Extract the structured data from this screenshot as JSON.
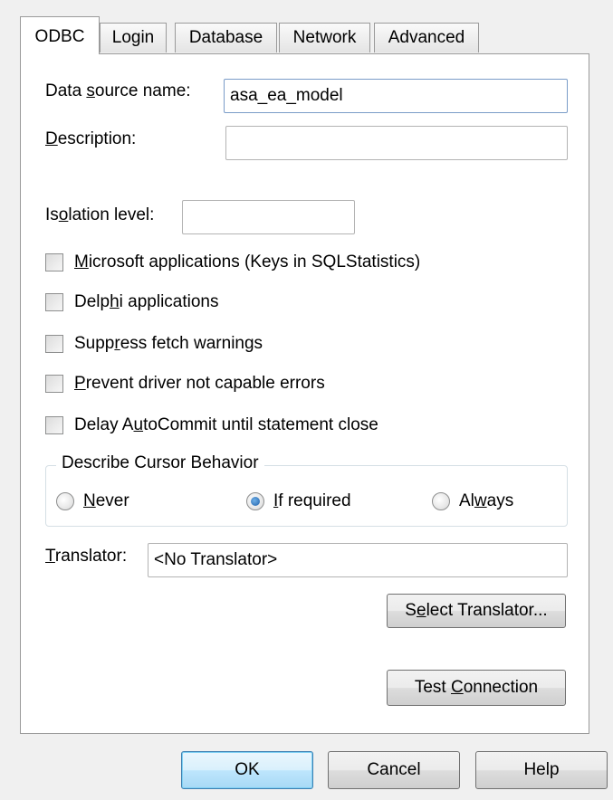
{
  "tabs": [
    {
      "label": "ODBC",
      "active": true
    },
    {
      "label": "Login"
    },
    {
      "label": "Database"
    },
    {
      "label": "Network"
    },
    {
      "label": "Advanced"
    }
  ],
  "fields": {
    "dsn_label_pre": "Data ",
    "dsn_label_ul": "s",
    "dsn_label_post": "ource name:",
    "dsn_value": "asa_ea_model",
    "desc_label_ul": "D",
    "desc_label_post": "escription:",
    "desc_value": "",
    "isolation_label_pre": "Is",
    "isolation_label_ul": "o",
    "isolation_label_post": "lation level:",
    "isolation_value": ""
  },
  "checkboxes": [
    {
      "pre": "",
      "ul": "M",
      "post": "icrosoft applications (Keys in SQLStatistics)",
      "checked": false
    },
    {
      "pre": "Delp",
      "ul": "h",
      "post": "i applications",
      "checked": false
    },
    {
      "pre": "Supp",
      "ul": "r",
      "post": "ess fetch warnings",
      "checked": false
    },
    {
      "pre": "",
      "ul": "P",
      "post": "revent driver not capable errors",
      "checked": false
    },
    {
      "pre": "Delay A",
      "ul": "u",
      "post": "toCommit until statement close",
      "checked": false
    }
  ],
  "cursor_group": {
    "title": "Describe Cursor Behavior",
    "options": [
      {
        "pre": "",
        "ul": "N",
        "post": "ever",
        "selected": false
      },
      {
        "pre": "",
        "ul": "I",
        "post": "f required",
        "selected": true
      },
      {
        "pre": "Al",
        "ul": "w",
        "post": "ays",
        "selected": false
      }
    ]
  },
  "translator": {
    "label_ul": "T",
    "label_post": "ranslator:",
    "value": "<No Translator>"
  },
  "buttons": {
    "select_translator_pre": "S",
    "select_translator_ul": "e",
    "select_translator_post": "lect Translator...",
    "test_connection_pre": "Test ",
    "test_connection_ul": "C",
    "test_connection_post": "onnection",
    "ok": "OK",
    "cancel": "Cancel",
    "help": "Help"
  }
}
